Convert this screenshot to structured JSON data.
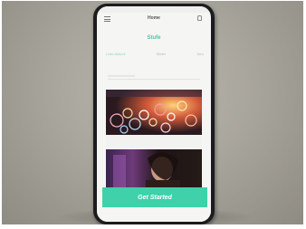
{
  "photo": {
    "background_color": "#aba89f",
    "phone_color": "#1c1c1e"
  },
  "app": {
    "page_title": "Home",
    "logo_text": "Stufe",
    "tabs": [
      {
        "label": "Liste Aktuell",
        "active": true
      },
      {
        "label": "Bilder",
        "active": false
      },
      {
        "label": "Neu",
        "active": false
      }
    ],
    "cta_label": "Get Started",
    "accent_color": "#3ed1aa"
  }
}
